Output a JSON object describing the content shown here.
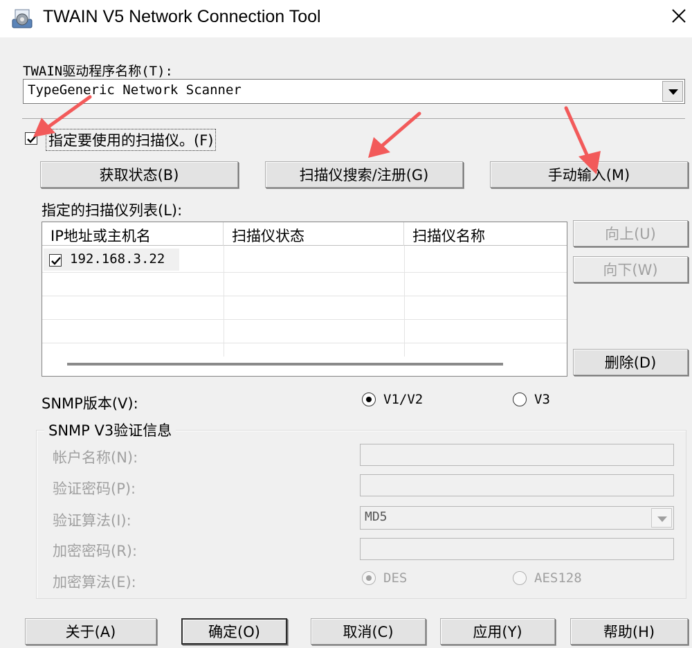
{
  "window": {
    "title": "TWAIN V5 Network Connection Tool",
    "close_glyph": "✕"
  },
  "driver": {
    "label": "TWAIN驱动程序名称(T):",
    "selected": "TypeGeneric Network Scanner"
  },
  "specify_scanner": {
    "label": "指定要使用的扫描仪。(F)",
    "checked": true
  },
  "actions": {
    "get_status": "获取状态(B)",
    "search_register": "扫描仪搜索/注册(G)",
    "manual_input": "手动输入(M)"
  },
  "scanner_list": {
    "label": "指定的扫描仪列表(L):",
    "columns": [
      "IP地址或主机名",
      "扫描仪状态",
      "扫描仪名称"
    ],
    "rows": [
      {
        "checked": true,
        "ip": "192.168.3.22",
        "status": "",
        "name": ""
      }
    ]
  },
  "list_buttons": {
    "up": "向上(U)",
    "down": "向下(W)",
    "delete": "删除(D)"
  },
  "snmp": {
    "label": "SNMP版本(V):",
    "options": [
      "V1/V2",
      "V3"
    ],
    "selected": "V1/V2"
  },
  "v3": {
    "group_title": "SNMP V3验证信息",
    "account_label": "帐户名称(N):",
    "auth_password_label": "验证密码(P):",
    "auth_algorithm_label": "验证算法(I):",
    "auth_algorithm_value": "MD5",
    "encrypt_password_label": "加密密码(R):",
    "encrypt_algorithm_label": "加密算法(E):",
    "encrypt_options": [
      "DES",
      "AES128"
    ],
    "encrypt_selected": "DES"
  },
  "footer": {
    "about": "关于(A)",
    "ok": "确定(O)",
    "cancel": "取消(C)",
    "apply": "应用(Y)",
    "help": "帮助(H)"
  },
  "colors": {
    "annotation_arrow": "#f25a5a",
    "disabled_text": "#a0a0a0"
  },
  "icons": {
    "app": "gear-scanner-icon",
    "close": "close-icon",
    "dropdown": "chevron-down-icon",
    "check": "check-icon"
  }
}
